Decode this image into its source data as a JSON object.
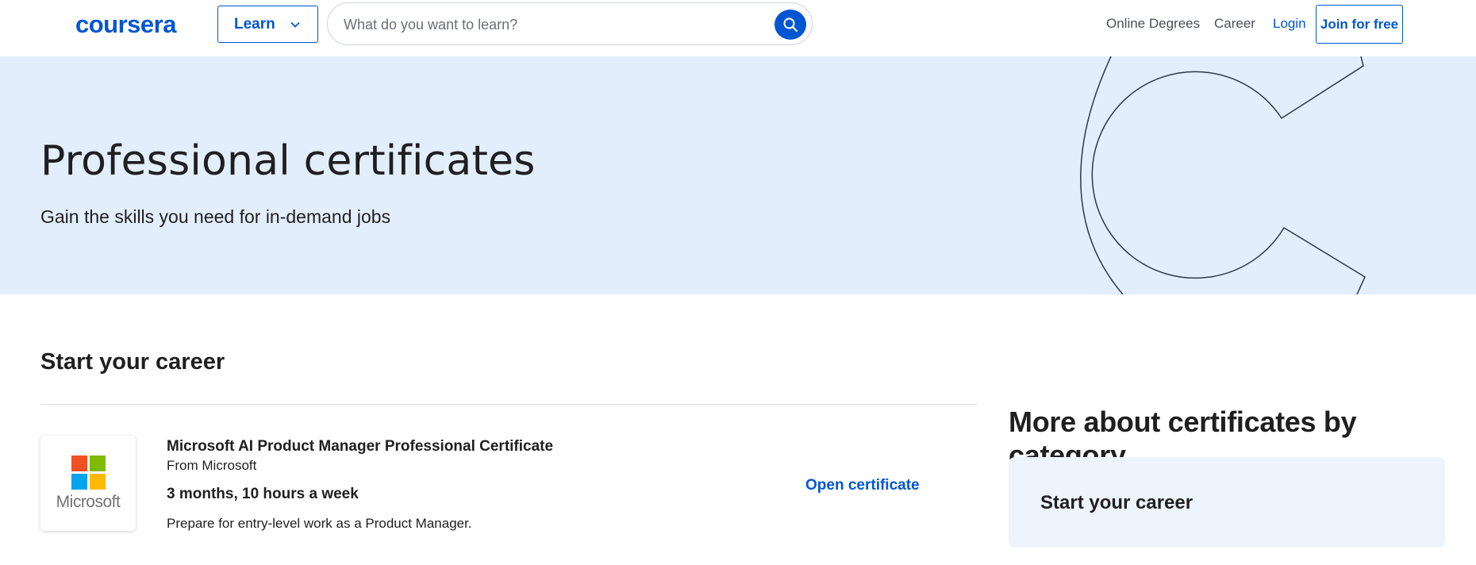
{
  "header": {
    "logo": "coursera",
    "learn_label": "Learn",
    "search_placeholder": "What do you want to learn?",
    "nav": [
      "Online Degrees",
      "Career",
      "Login"
    ],
    "join_label": "Join for free"
  },
  "hero": {
    "title": "Professional certificates",
    "subtitle": "Gain the skills you need for in-demand jobs"
  },
  "main": {
    "section_title": "Start your career",
    "certificate": {
      "logo_text": "Microsoft",
      "title": "Microsoft AI Product Manager Professional Certificate",
      "from": "From Microsoft",
      "duration": "3 months, 10 hours a week",
      "description": "Prepare for entry-level work as a Product Manager.",
      "open_label": "Open certificate"
    }
  },
  "sidebar": {
    "title": "More about certificates by category",
    "card_label": "Start your career"
  },
  "colors": {
    "brand": "#0056d2",
    "hero_bg": "#e3eefc",
    "card_bg": "#eef4fd",
    "ms_red": "#f25022",
    "ms_green": "#7fba00",
    "ms_blue": "#00a4ef",
    "ms_yellow": "#ffb900"
  }
}
